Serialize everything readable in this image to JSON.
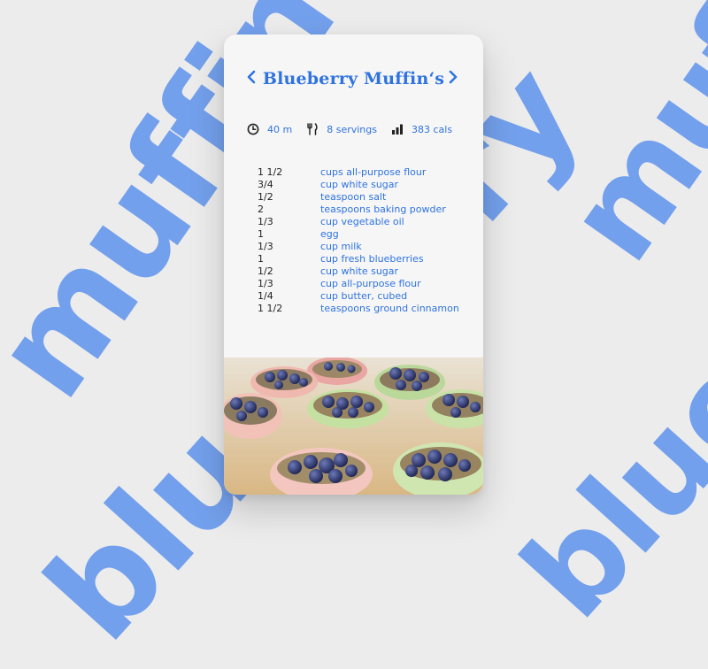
{
  "background": {
    "word_top": "muffin",
    "word_bottom": "blueberry"
  },
  "recipe": {
    "title": "Blueberry Muffin‘s",
    "time": "40 m",
    "servings": "8 servings",
    "calories": "383 cals"
  },
  "ingredients": [
    {
      "qty": "1 1/2",
      "name": "cups all-purpose flour"
    },
    {
      "qty": "3/4",
      "name": "cup white sugar"
    },
    {
      "qty": "1/2",
      "name": "teaspoon salt"
    },
    {
      "qty": "2",
      "name": "teaspoons baking powder"
    },
    {
      "qty": "1/3",
      "name": "cup vegetable oil"
    },
    {
      "qty": "1",
      "name": "egg"
    },
    {
      "qty": "1/3",
      "name": "cup milk"
    },
    {
      "qty": "1",
      "name": "cup fresh blueberries"
    },
    {
      "qty": "1/2",
      "name": "cup white sugar"
    },
    {
      "qty": "1/3",
      "name": "cup all-purpose flour"
    },
    {
      "qty": "1/4",
      "name": "cup butter, cubed"
    },
    {
      "qty": "1 1/2",
      "name": "teaspoons ground cinnamon"
    }
  ],
  "icons": {
    "prev": "chevron-left-icon",
    "next": "chevron-right-icon",
    "time": "clock-icon",
    "servings": "fork-knife-icon",
    "calories": "bar-chart-icon"
  },
  "colors": {
    "accent": "#2f73e0",
    "background_word": "#5f93ec",
    "card": "#f6f6f6"
  }
}
